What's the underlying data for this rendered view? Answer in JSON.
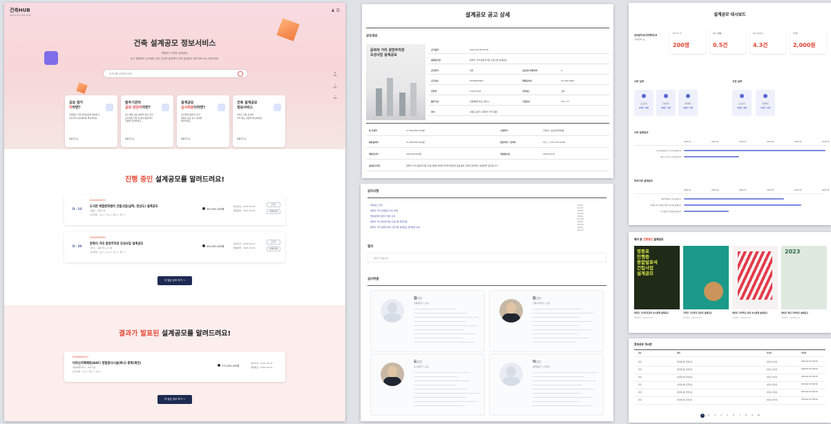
{
  "main": {
    "logo": "건축HUB",
    "logo_sub": "ARCHITECTURE HUB",
    "title": "건축 설계공모 정보서비스",
    "subtitle1": "복잡하고 어려운 설계공모,",
    "subtitle2": "공고 등록부터 심사위원 선정, 당선작 발표까지 건축 설계공모 정보서비스로 시작하세요.",
    "search_placeholder": "검색어를 입력해주세요",
    "side": [
      "목록",
      "알림",
      "TOP"
    ],
    "cards": [
      {
        "pre": "공모 참가",
        "hl": "자",
        "post": "라면?",
        "desc": "진행중인 건축 설계공모에 참여하고,\n당선작과 심사결과를 확인하세요.",
        "btn": "바로가기 ▸"
      },
      {
        "pre": "발주기관의",
        "hl": "공모 담당자",
        "post": "라면?",
        "desc": "쉽고 빠른 공모 등록과 공모 관리\n심사위원 추첨 및 결과 발표까지\n한번에 관리하세요.",
        "btn": "바로가기 ▸"
      },
      {
        "pre": "설계공모",
        "hl": "심사위원",
        "post": "이라면?",
        "desc": "심사위원 등록 및 관리\n배정된 공모 심사 일정을\n확인하세요.",
        "btn": "바로가기 ▸"
      },
      {
        "pre": "건축 설계공모",
        "hl": "",
        "post": "정보서비스",
        "desc": "서비스 이용 안내와\n자주 묻는 질문을 확인하세요.",
        "btn": "바로가기 ▸"
      }
    ],
    "ongoing_pre": "진행 중인",
    "ongoing_post": " 설계공모를 알려드려요!",
    "result_pre": "결과가 발표된",
    "result_post": " 설계공모를 알려드려요!",
    "ongoing": [
      {
        "code": "D240800070",
        "dday": "D - 13",
        "title": "도서관 복합문화센터 건립사업(삼척, 정선도) 설계공모",
        "meta": "강원도   ·   문화시설",
        "meta2": "심사위원 : 김○○, 이○○, 박○○, 최○○",
        "amount": "550,000,000원",
        "d1": "접수마감 : 2024-02-28",
        "d2": "발표예정 : 2024-03-05",
        "b1": "공고문",
        "b2": "설계지침서"
      },
      {
        "code": "D240800050",
        "dday": "D - 20",
        "title": "문화의 거리 광장주차장 조성사업 설계공모",
        "meta": "경기도   ·   공원 및 도시시설",
        "meta2": "심사위원 : 김○○, 도○○, 이○○, 정○○",
        "amount": "400,000,000원",
        "d1": "접수마감 : 2024-03-21",
        "d2": "발표예정 : 2024-04-02",
        "b1": "공고문",
        "b2": "설계지침서"
      }
    ],
    "result": [
      {
        "code": "D240800010",
        "title": "어르신치매예방(ASF) 정밀검사시설(복나) 증축(재건)",
        "meta": "세종특별자치시   ·   복지시설",
        "meta2": "심사위원 : 김○○, 박○○, 이○○",
        "amount": "275,000,000원",
        "d1": "접수마감 : 2024-02-07",
        "d2": "결과발표 : 2024-02-26"
      }
    ],
    "more": "더 많은 공모 보기  →"
  },
  "detail": {
    "title": "설계공모 공고 상세",
    "section": "공모개요",
    "poster_title": "문화의 거리 광장주차장\n조성사업 설계공모",
    "rows": [
      [
        "공고일자",
        "2024-02-08 09:00"
      ],
      [
        "설계공모명",
        "문화의 거리 광장주차장 조성사업 설계공모"
      ],
      [
        "공모방식",
        "일반",
        "공동응모허용여부",
        "O"
      ],
      [
        "공고번호",
        "D240800050",
        "전화문의처",
        "02-000-0000"
      ],
      [
        "연면적",
        "6,670.00㎡",
        "건축용도",
        "교육"
      ],
      [
        "발주기관",
        "강원특별자치도 원주시",
        "기관문의",
        "031-****"
      ],
      [
        "위치",
        "강원도 원주시 문화의 거리 일원"
      ]
    ],
    "rows2": [
      [
        "총 사업비",
        "17,946,000,000원",
        "소재지역",
        "건축과 / 공공건축지원팀"
      ],
      [
        "예정설계비",
        "71,666,000,000원",
        "담당자명 / 연락처",
        "이○○ / 033-737-0000"
      ],
      [
        "예정공사비",
        "440,543,000원",
        "작품접수일",
        "2024-03-21"
      ],
      [
        "설계공모개요",
        "문화의 거리 광장주차장 조성사업에 대하여 지역의 특성과 공공성을 고려한 창의적인 설계안을 공모합니다."
      ]
    ]
  },
  "notice": {
    "title": "공지사항",
    "items": [
      [
        "정정공고 안내",
        "2024-02-27"
      ],
      [
        "문화의 거리 설계공모 FAQ 답변",
        "2024-02-23"
      ],
      [
        "현장설명회 참석자 명단 안내",
        "2024-02-20"
      ],
      [
        "문화의 거리 광장주차장 조성사업 질의답변",
        "2024-02-15"
      ],
      [
        "문화의 거리 광장주차장 조성사업 설계공모 질의응답 안내",
        "2024-02-10"
      ]
    ],
    "qna_title": "질의",
    "qna_item": "질의가 없습니다.",
    "jury_title": "심사위원",
    "jury": [
      {
        "name": "김○○",
        "role": "건축전문가 | 교수"
      },
      {
        "name": "김○○",
        "role": "건축사사무소 | 소장"
      },
      {
        "name": "도○○",
        "role": "도시전문가 | 교수"
      },
      {
        "name": "이○○",
        "role": "설계전문가 | 건축사"
      }
    ]
  },
  "dash": {
    "title": "설계공모 대시보드",
    "org": "공공발주(공기관제외)/N",
    "org_sub": "인천광역시교",
    "stats": [
      [
        "접수건수 총",
        "200명"
      ],
      [
        "평균 경쟁률",
        "0.5건"
      ],
      [
        "평균 심사기간",
        "4.3건"
      ],
      [
        "진행중",
        "2,000원"
      ]
    ],
    "sec1": "나의 실적",
    "sec2": "기관 실적",
    "mini": [
      [
        "공고등록",
        "24건 / 8건"
      ],
      [
        "심사진행",
        "20건 / 5건"
      ],
      [
        "결과발표",
        "18건 / 3건"
      ],
      [
        "공고등록",
        "24건 / 8건"
      ],
      [
        "결과발표",
        "11건 / 2건"
      ]
    ],
    "gantt1": "나의 설계공모",
    "gantt2": "우리기관 설계공모",
    "months": [
      "2024.01",
      "2024.02",
      "2024.03",
      "2024.04",
      "2024.05",
      "2024.06"
    ],
    "g1rows": [
      "학교용 설계공모 학교건축 설계공모",
      "대학교 기숙사 신축 설계공모"
    ],
    "g2rows": [
      "행정복지센터 신축 설계공모",
      "문화의 거리 광장주차장 조성사업 설계공모",
      "시청 별관 리모델링 설계공모"
    ]
  },
  "gallery": {
    "title_pre": "제가 본 ",
    "title_hl": "진행중인",
    "title_post": " 설계공모",
    "items": [
      [
        "대지조 기숙학교건축 수시진행 설계공모",
        "마감일자 : 2024-03-21"
      ],
      [
        "가지조 기숙학교 건축조 설계공모",
        "마감일자 : 2024-03-21"
      ],
      [
        "대지조 가지학교 건축 수시진행 설계공모",
        "마감일자 : 2024-03-21"
      ],
      [
        "대지조 청년 가치학교 설계공모",
        "마감일자 : 2024-03-21"
      ]
    ],
    "p1text": "영등포\n진행중\n종합발표석\n건립사업\n설계공모",
    "p4text": "2023"
  },
  "board": {
    "title": "정보공유 게시판",
    "headers": [
      "번호",
      "제목",
      "작성자",
      "작성일"
    ],
    "rows": [
      [
        "자유",
        "자유게시판 글입니다",
        "서울시 관리자",
        "2024-02-07 09:00"
      ],
      [
        "자유",
        "자유게시판 글입니다",
        "서울시 관리자",
        "2024-02-07 09:00"
      ],
      [
        "자유",
        "자유게시판 글입니다",
        "서울시 관리자",
        "2024-02-07 09:00"
      ],
      [
        "자유",
        "자유게시판 글입니다",
        "서울시 관리자",
        "2024-02-07 09:00"
      ],
      [
        "자유",
        "자유게시판 글입니다",
        "서울시 관리자",
        "2024-02-07 09:00"
      ],
      [
        "자유",
        "자유게시판 글입니다",
        "서울시 관리자",
        "2024-02-07 09:00"
      ]
    ],
    "pages": [
      "1",
      "2",
      "3",
      "4",
      "5",
      "6",
      "7",
      "8",
      "9",
      "10"
    ]
  }
}
